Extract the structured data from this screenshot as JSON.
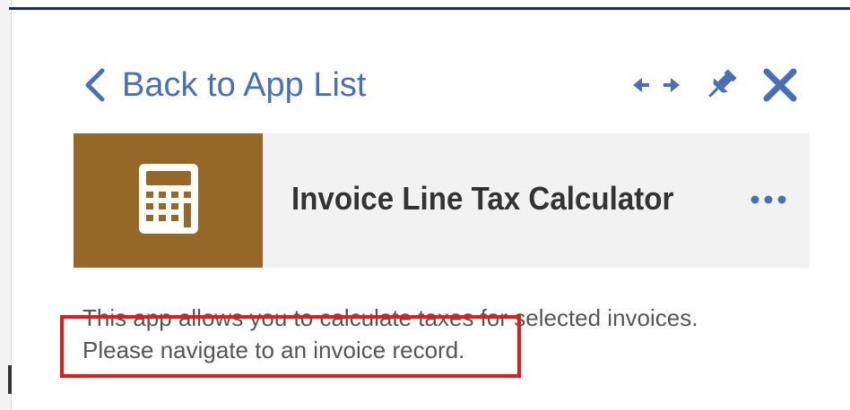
{
  "panel": {
    "back_label": "Back to App List",
    "icons": {
      "back": "chevron-left-icon",
      "expand": "expand-arrows-icon",
      "pin": "pin-icon",
      "close": "close-icon"
    }
  },
  "app": {
    "title": "Invoice Line Tax Calculator",
    "tile_icon": "calculator-icon",
    "tile_color": "#966828",
    "more_icon": "more-horizontal-icon"
  },
  "description": {
    "line1": "This app allows you to calculate taxes for selected invoices.",
    "line2": "Please navigate to an invoice record."
  },
  "colors": {
    "accent": "#4a6fb3",
    "highlight": "#e31b1b"
  }
}
